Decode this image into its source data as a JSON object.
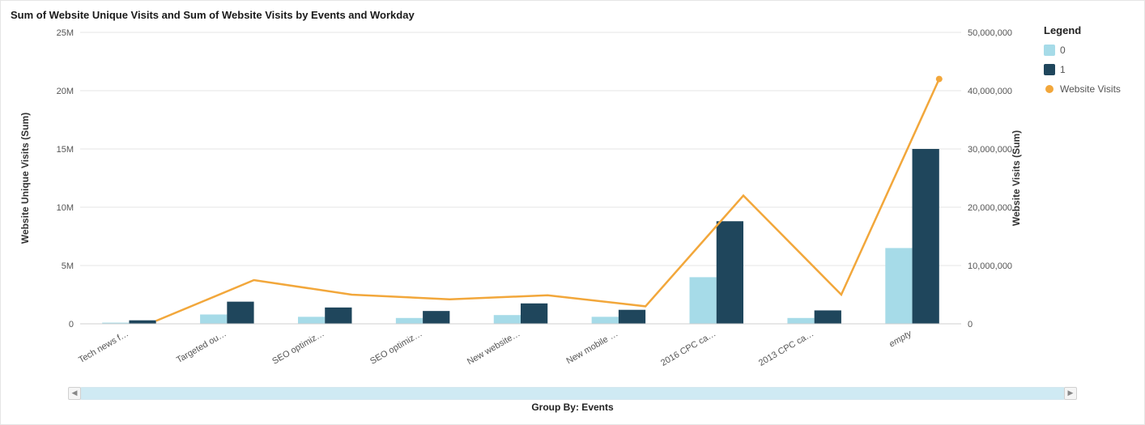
{
  "title": "Sum of Website Unique Visits and Sum of Website Visits by Events and Workday",
  "legend": {
    "title": "Legend",
    "items": [
      {
        "label": "0",
        "kind": "swatch",
        "color": "#a6dbe8"
      },
      {
        "label": "1",
        "kind": "swatch",
        "color": "#1f465c"
      },
      {
        "label": "Website Visits",
        "kind": "dot",
        "color": "#f2a73b"
      }
    ]
  },
  "axes": {
    "x_title": "Group By: Events",
    "y_left_label": "Website Unique Visits (Sum)",
    "y_right_label": "Website Visits (Sum)",
    "y_left_ticks": [
      0,
      5000000,
      10000000,
      15000000,
      20000000,
      25000000
    ],
    "y_left_tick_labels": [
      "0",
      "5M",
      "10M",
      "15M",
      "20M",
      "25M"
    ],
    "y_right_ticks": [
      0,
      10000000,
      20000000,
      30000000,
      40000000,
      50000000
    ],
    "y_right_tick_labels": [
      "0",
      "10,000,000",
      "20,000,000",
      "30,000,000",
      "40,000,000",
      "50,000,000"
    ]
  },
  "chart_data": {
    "type": "bar",
    "categories": [
      "Tech news f…",
      "Targeted ou…",
      "SEO optimiz…",
      "SEO optimiz…",
      "New website…",
      "New mobile …",
      "2016 CPC ca…",
      "2013 CPC ca…",
      "empty"
    ],
    "series": [
      {
        "name": "0",
        "values": [
          100000,
          800000,
          600000,
          500000,
          750000,
          600000,
          4000000,
          500000,
          6500000
        ],
        "axis": "left",
        "color": "#a6dbe8"
      },
      {
        "name": "1",
        "values": [
          300000,
          1900000,
          1400000,
          1100000,
          1750000,
          1200000,
          8800000,
          1150000,
          15000000
        ],
        "axis": "left",
        "color": "#1f465c"
      },
      {
        "name": "Website Visits",
        "values": [
          500000,
          7500000,
          5000000,
          4200000,
          4900000,
          3000000,
          22000000,
          5000000,
          42000000
        ],
        "axis": "right",
        "type": "line",
        "color": "#f2a73b"
      }
    ],
    "y_left_range": [
      0,
      25000000
    ],
    "y_right_range": [
      0,
      50000000
    ],
    "xlabel": "Group By: Events",
    "ylabel_left": "Website Unique Visits (Sum)",
    "ylabel_right": "Website Visits (Sum)"
  }
}
